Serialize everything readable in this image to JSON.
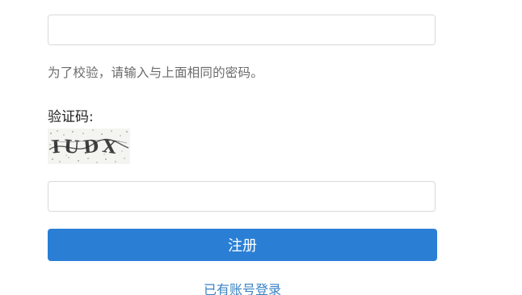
{
  "form": {
    "confirm_password": {
      "value": "",
      "placeholder": ""
    },
    "confirm_help": "为了校验，请输入与上面相同的密码。",
    "captcha_label": "验证码:",
    "captcha_image_text": "IUDX",
    "captcha_input": {
      "value": "",
      "placeholder": ""
    },
    "submit_label": "注册",
    "login_link": "已有账号登录"
  },
  "colors": {
    "primary": "#2a7fd4",
    "link": "#3a82c4",
    "help_text": "#6b6b6b",
    "border": "#d9d9d9"
  }
}
